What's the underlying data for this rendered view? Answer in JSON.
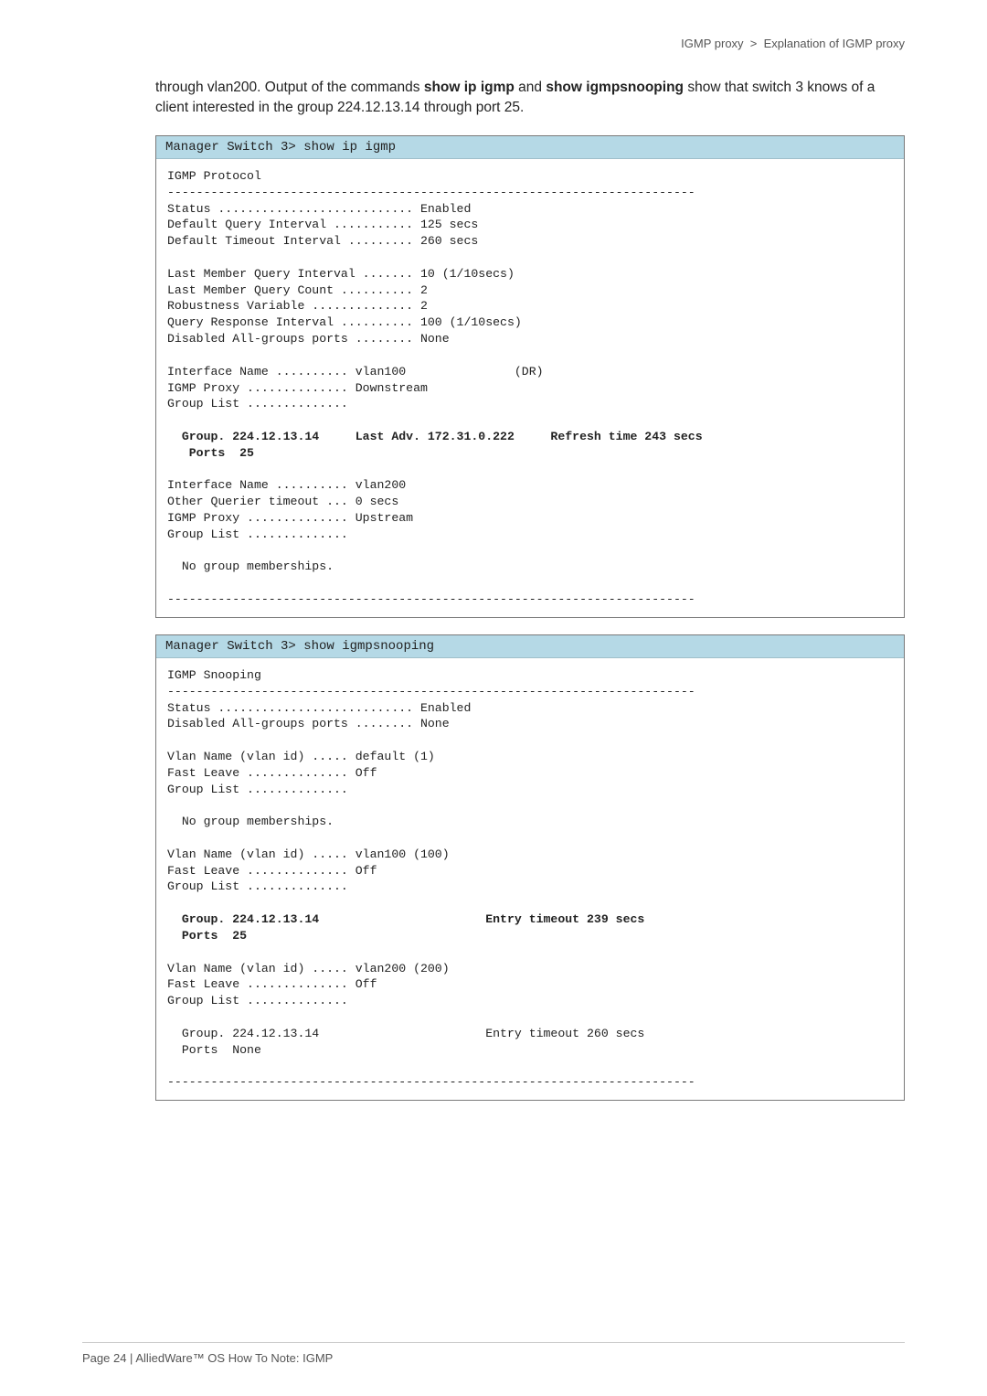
{
  "header": {
    "path_left": "IGMP proxy",
    "path_right": "Explanation of IGMP proxy"
  },
  "intro": {
    "text_before": "through vlan200. Output of the commands ",
    "cmd1": "show ip igmp",
    "mid": " and ",
    "cmd2": "show igmpsnooping",
    "text_after": " show that switch 3 knows of a client interested in the group 224.12.13.14 through port 25."
  },
  "box1": {
    "bar": "Manager Switch 3> show ip igmp",
    "body_top": "IGMP Protocol\n-------------------------------------------------------------------------\nStatus ........................... Enabled\nDefault Query Interval ........... 125 secs\nDefault Timeout Interval ......... 260 secs\n\nLast Member Query Interval ....... 10 (1/10secs)\nLast Member Query Count .......... 2\nRobustness Variable .............. 2\nQuery Response Interval .......... 100 (1/10secs)\nDisabled All-groups ports ........ None\n\nInterface Name .......... vlan100               (DR)\nIGMP Proxy .............. Downstream\nGroup List ..............",
    "bold_line1": "  Group. 224.12.13.14     Last Adv. 172.31.0.222     Refresh time 243 secs",
    "bold_line2": "   Ports  25",
    "body_bottom": "\n\nInterface Name .......... vlan200\nOther Querier timeout ... 0 secs\nIGMP Proxy .............. Upstream\nGroup List ..............\n\n  No group memberships.\n\n-------------------------------------------------------------------------"
  },
  "box2": {
    "bar": "Manager Switch 3> show igmpsnooping",
    "body_top": "IGMP Snooping\n-------------------------------------------------------------------------\nStatus ........................... Enabled\nDisabled All-groups ports ........ None\n\nVlan Name (vlan id) ..... default (1)\nFast Leave .............. Off\nGroup List ..............\n\n  No group memberships.\n\nVlan Name (vlan id) ..... vlan100 (100)\nFast Leave .............. Off\nGroup List ..............",
    "bold_line1": "  Group. 224.12.13.14                       Entry timeout 239 secs",
    "bold_line2": "  Ports  25",
    "body_bottom": "\n\nVlan Name (vlan id) ..... vlan200 (200)\nFast Leave .............. Off\nGroup List ..............\n\n  Group. 224.12.13.14                       Entry timeout 260 secs\n  Ports  None\n\n-------------------------------------------------------------------------"
  },
  "footer": {
    "text": "Page 24 | AlliedWare™ OS How To Note: IGMP"
  }
}
